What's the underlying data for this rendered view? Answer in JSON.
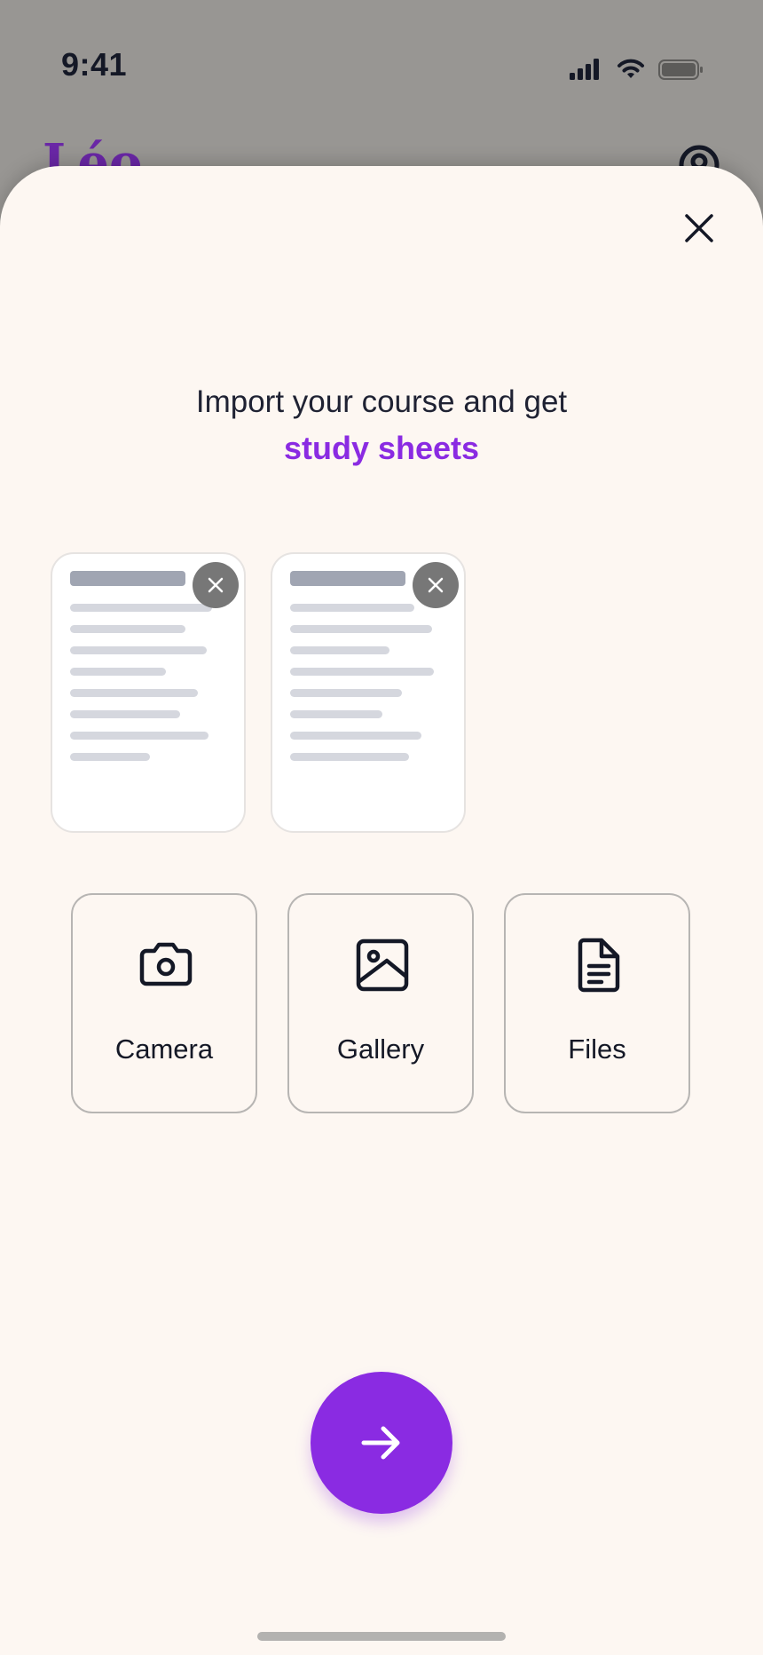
{
  "status_bar": {
    "time": "9:41",
    "icons": [
      "cellular-signal-icon",
      "wifi-icon",
      "battery-icon"
    ]
  },
  "background": {
    "app_title": "Léo",
    "profile_icon": "profile-icon"
  },
  "modal": {
    "close_icon": "close-icon",
    "headline": {
      "line1": "Import your course and get",
      "accent": "study sheets"
    },
    "thumbnails": [
      {
        "name": "document-thumbnail-1",
        "remove_icon": "close-icon"
      },
      {
        "name": "document-thumbnail-2",
        "remove_icon": "close-icon"
      }
    ],
    "options": [
      {
        "label": "Camera",
        "icon": "camera-icon"
      },
      {
        "label": "Gallery",
        "icon": "image-icon"
      },
      {
        "label": "Files",
        "icon": "file-icon"
      }
    ],
    "next_icon": "arrow-right-icon"
  },
  "colors": {
    "accent": "#8a2be2",
    "sheet_background": "#fdf7f2",
    "overlay": "#989693",
    "text": "#141826"
  }
}
